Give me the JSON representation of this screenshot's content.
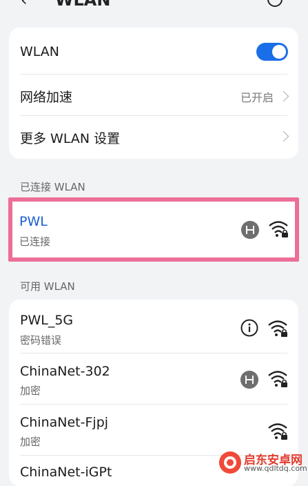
{
  "header": {
    "back_icon": "back-arrow-icon",
    "title": "WLAN",
    "help_icon": "help-icon"
  },
  "settings": {
    "wlan_label": "WLAN",
    "wlan_enabled": true,
    "accel_label": "网络加速",
    "accel_value": "已开启",
    "more_label": "更多 WLAN 设置"
  },
  "connected": {
    "section_title": "已连接 WLAN",
    "network": {
      "name": "PWL",
      "status": "已连接",
      "icons": [
        "hotspot-icon",
        "wifi-lock-icon"
      ]
    }
  },
  "available": {
    "section_title": "可用 WLAN",
    "networks": [
      {
        "name": "PWL_5G",
        "status": "密码错误",
        "icons": [
          "info-icon",
          "wifi-lock-icon"
        ]
      },
      {
        "name": "ChinaNet-302",
        "status": "加密",
        "icons": [
          "hotspot-icon",
          "wifi-lock-icon"
        ]
      },
      {
        "name": "ChinaNet-Fjpj",
        "status": "加密",
        "icons": [
          "wifi-lock-icon"
        ]
      },
      {
        "name": "ChinaNet-iGPt",
        "status": "",
        "icons": []
      }
    ]
  },
  "watermark": {
    "text": "启东安卓网",
    "url": "www.qdltdq.com"
  },
  "colors": {
    "accent": "#1a6fe8",
    "highlight": "#ed6e96",
    "connected_name": "#1a5fd0"
  }
}
